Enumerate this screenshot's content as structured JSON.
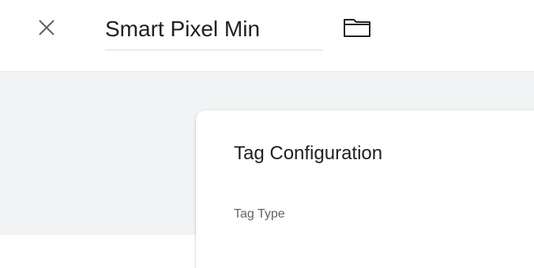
{
  "header": {
    "close_icon": "close-icon",
    "tag_name": "Smart Pixel Min",
    "folder_icon": "folder-icon"
  },
  "card": {
    "title": "Tag Configuration",
    "tag_type_label": "Tag Type"
  },
  "colors": {
    "background": "#f1f3f4",
    "card": "#ffffff",
    "text": "#202124",
    "muted_text": "#5f6368",
    "icon": "#5f6368"
  }
}
